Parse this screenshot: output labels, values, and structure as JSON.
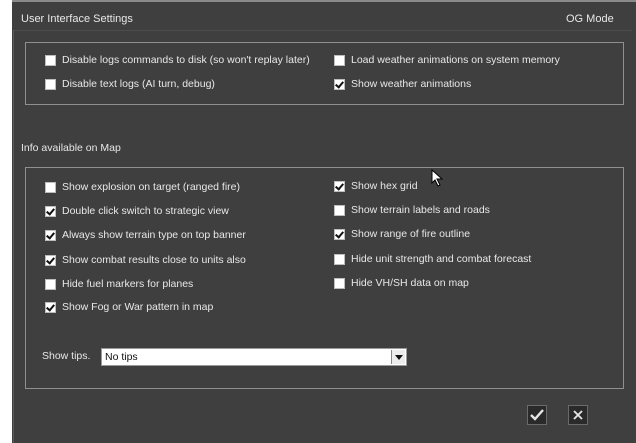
{
  "header": {
    "title": "User Interface Settings",
    "mode": "OG Mode"
  },
  "logs_panel": {
    "left": [
      {
        "label": "Disable logs commands to disk (so won't replay later)",
        "checked": false
      },
      {
        "label": "Disable text logs (AI turn, debug)",
        "checked": false
      }
    ],
    "right": [
      {
        "label": "Load weather animations on system memory",
        "checked": false
      },
      {
        "label": "Show weather animations",
        "checked": true
      }
    ]
  },
  "map_section": {
    "title": "Info available on Map",
    "left": [
      {
        "label": "Show explosion on target (ranged fire)",
        "checked": false
      },
      {
        "label": "Double click switch to strategic view",
        "checked": true
      },
      {
        "label": "Always show terrain type on top banner",
        "checked": true
      },
      {
        "label": "Show combat results close to units also",
        "checked": true
      },
      {
        "label": "Hide fuel markers for planes",
        "checked": false
      },
      {
        "label": "Show Fog or War pattern in map",
        "checked": true
      }
    ],
    "right": [
      {
        "label": "Show hex grid",
        "checked": true
      },
      {
        "label": "Show terrain labels and roads",
        "checked": false
      },
      {
        "label": "Show range of fire outline",
        "checked": true
      },
      {
        "label": "Hide unit strength and combat forecast",
        "checked": false
      },
      {
        "label": "Hide VH/SH data on map",
        "checked": false
      }
    ]
  },
  "tips": {
    "label": "Show tips.",
    "value": "No tips"
  },
  "icons": {
    "confirm": "checkmark-icon",
    "cancel": "close-icon"
  }
}
